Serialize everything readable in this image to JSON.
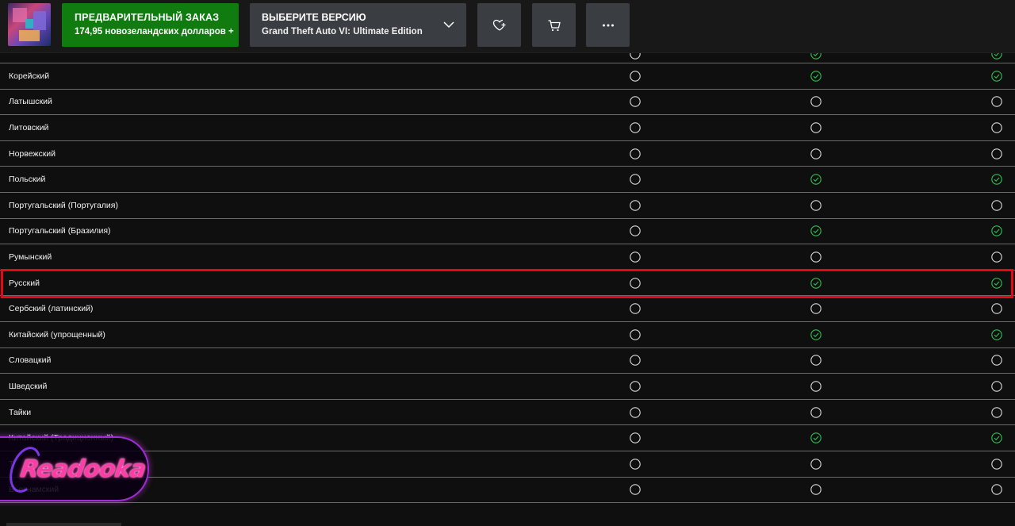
{
  "header": {
    "thumbnail_alt": "Grand Theft Auto VI cover art",
    "preorder": {
      "title": "ПРЕДВАРИТЕЛЬНЫЙ ЗАКАЗ",
      "price": "174,95 новозеландских долларов +"
    },
    "version": {
      "label": "ВЫБЕРИТЕ ВЕРСИЮ",
      "value": "Grand Theft Auto VI: Ultimate Edition"
    },
    "buttons": [
      "wishlist-heart-icon",
      "cart-icon",
      "more-icon"
    ]
  },
  "colors": {
    "accent_green": "#107c10",
    "check_green": "#2fbf4f",
    "highlight_red": "#e50914",
    "background": "#0f0f0f"
  },
  "languages": [
    {
      "name": "",
      "support": [
        false,
        true,
        true
      ],
      "partial": true
    },
    {
      "name": "Корейский",
      "support": [
        false,
        true,
        true
      ]
    },
    {
      "name": "Латышский",
      "support": [
        false,
        false,
        false
      ]
    },
    {
      "name": "Литовский",
      "support": [
        false,
        false,
        false
      ]
    },
    {
      "name": "Норвежский",
      "support": [
        false,
        false,
        false
      ]
    },
    {
      "name": "Польский",
      "support": [
        false,
        true,
        true
      ]
    },
    {
      "name": "Португальский (Португалия)",
      "support": [
        false,
        false,
        false
      ]
    },
    {
      "name": "Португальский (Бразилия)",
      "support": [
        false,
        true,
        true
      ]
    },
    {
      "name": "Румынский",
      "support": [
        false,
        false,
        false
      ]
    },
    {
      "name": "Русский",
      "support": [
        false,
        true,
        true
      ],
      "highlighted": true
    },
    {
      "name": "Сербский (латинский)",
      "support": [
        false,
        false,
        false
      ]
    },
    {
      "name": "Китайский (упрощенный)",
      "support": [
        false,
        true,
        true
      ]
    },
    {
      "name": "Словацкий",
      "support": [
        false,
        false,
        false
      ]
    },
    {
      "name": "Шведский",
      "support": [
        false,
        false,
        false
      ]
    },
    {
      "name": "Тайки",
      "support": [
        false,
        false,
        false
      ]
    },
    {
      "name": "Китайский (Традиционный)",
      "support": [
        false,
        true,
        true
      ]
    },
    {
      "name": "Т",
      "support": [
        false,
        false,
        false
      ]
    },
    {
      "name": "Вьетнамский",
      "support": [
        false,
        false,
        false
      ]
    }
  ],
  "watermark": {
    "text": "Readooka"
  }
}
